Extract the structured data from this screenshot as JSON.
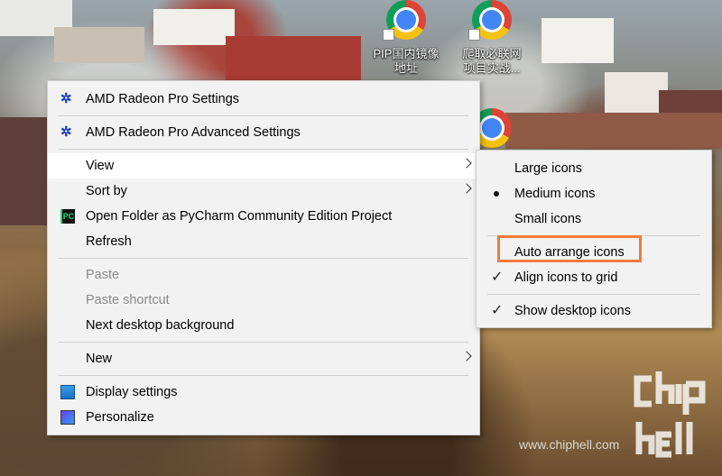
{
  "desktop": {
    "icons": [
      {
        "label_line1": "PIP国内镜像",
        "label_line2": "地址",
        "icon": "chrome-shortcut-icon"
      },
      {
        "label_line1": "爬取必联网",
        "label_line2": "项目实战...",
        "icon": "chrome-shortcut-icon"
      },
      {
        "label_line1": "",
        "label_line2": "",
        "icon": "chrome-icon"
      }
    ]
  },
  "context_menu": {
    "items": [
      {
        "label": "AMD Radeon Pro Settings",
        "icon": "amd-radeon-icon"
      },
      {
        "label": "AMD Radeon Pro Advanced Settings",
        "icon": "amd-radeon-icon"
      },
      {
        "label": "View",
        "submenu": true
      },
      {
        "label": "Sort by",
        "submenu": true
      },
      {
        "label": "Open Folder as PyCharm Community Edition Project",
        "icon": "pycharm-icon",
        "icon_text": "PC"
      },
      {
        "label": "Refresh"
      },
      {
        "label": "Paste",
        "disabled": true
      },
      {
        "label": "Paste shortcut",
        "disabled": true
      },
      {
        "label": "Next desktop background"
      },
      {
        "label": "New",
        "submenu": true
      },
      {
        "label": "Display settings",
        "icon": "display-settings-icon"
      },
      {
        "label": "Personalize",
        "icon": "personalize-icon"
      }
    ]
  },
  "view_submenu": {
    "items": [
      {
        "label": "Large icons",
        "marker": ""
      },
      {
        "label": "Medium icons",
        "marker": "bullet"
      },
      {
        "label": "Small icons",
        "marker": ""
      },
      {
        "label": "Auto arrange icons",
        "marker": "",
        "highlighted_box": true
      },
      {
        "label": "Align icons to grid",
        "marker": "check"
      },
      {
        "label": "Show desktop icons",
        "marker": "check"
      }
    ],
    "check_glyph": "✓",
    "highlight_color": "#f07b3f"
  },
  "watermark": {
    "logo": "chip hell",
    "url": "www.chiphell.com"
  }
}
